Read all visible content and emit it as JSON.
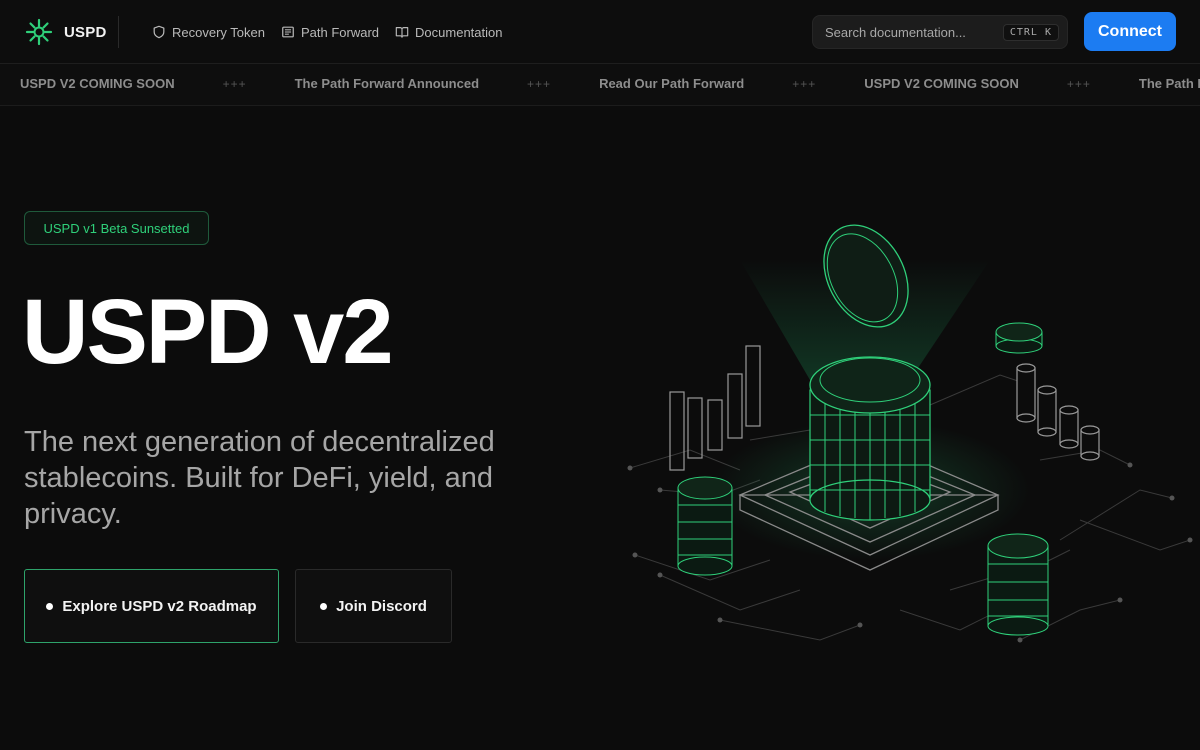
{
  "header": {
    "brand_name": "USPD",
    "nav": [
      {
        "label": "Recovery Token",
        "icon": "shield-icon"
      },
      {
        "label": "Path Forward",
        "icon": "newspaper-icon"
      },
      {
        "label": "Documentation",
        "icon": "book-icon"
      }
    ],
    "search": {
      "placeholder": "Search documentation...",
      "shortcut": "CTRL K"
    },
    "connect_label": "Connect"
  },
  "ticker": {
    "items": [
      "USPD V2 COMING SOON",
      "The Path Forward Announced",
      "Read Our Path Forward",
      "USPD V2 COMING SOON",
      "The Path Forward"
    ],
    "separator": "+++"
  },
  "hero": {
    "badge": "USPD v1 Beta Sunsetted",
    "title": "USPD v2",
    "subtitle": "The next generation of decentralized stablecoins. Built for DeFi, yield, and privacy.",
    "primary_button": "Explore USPD v2 Roadmap",
    "secondary_button": "Join Discord"
  },
  "colors": {
    "accent_green": "#2fd07a",
    "connect_blue": "#1c7cf2",
    "background": "#0c0c0c"
  }
}
